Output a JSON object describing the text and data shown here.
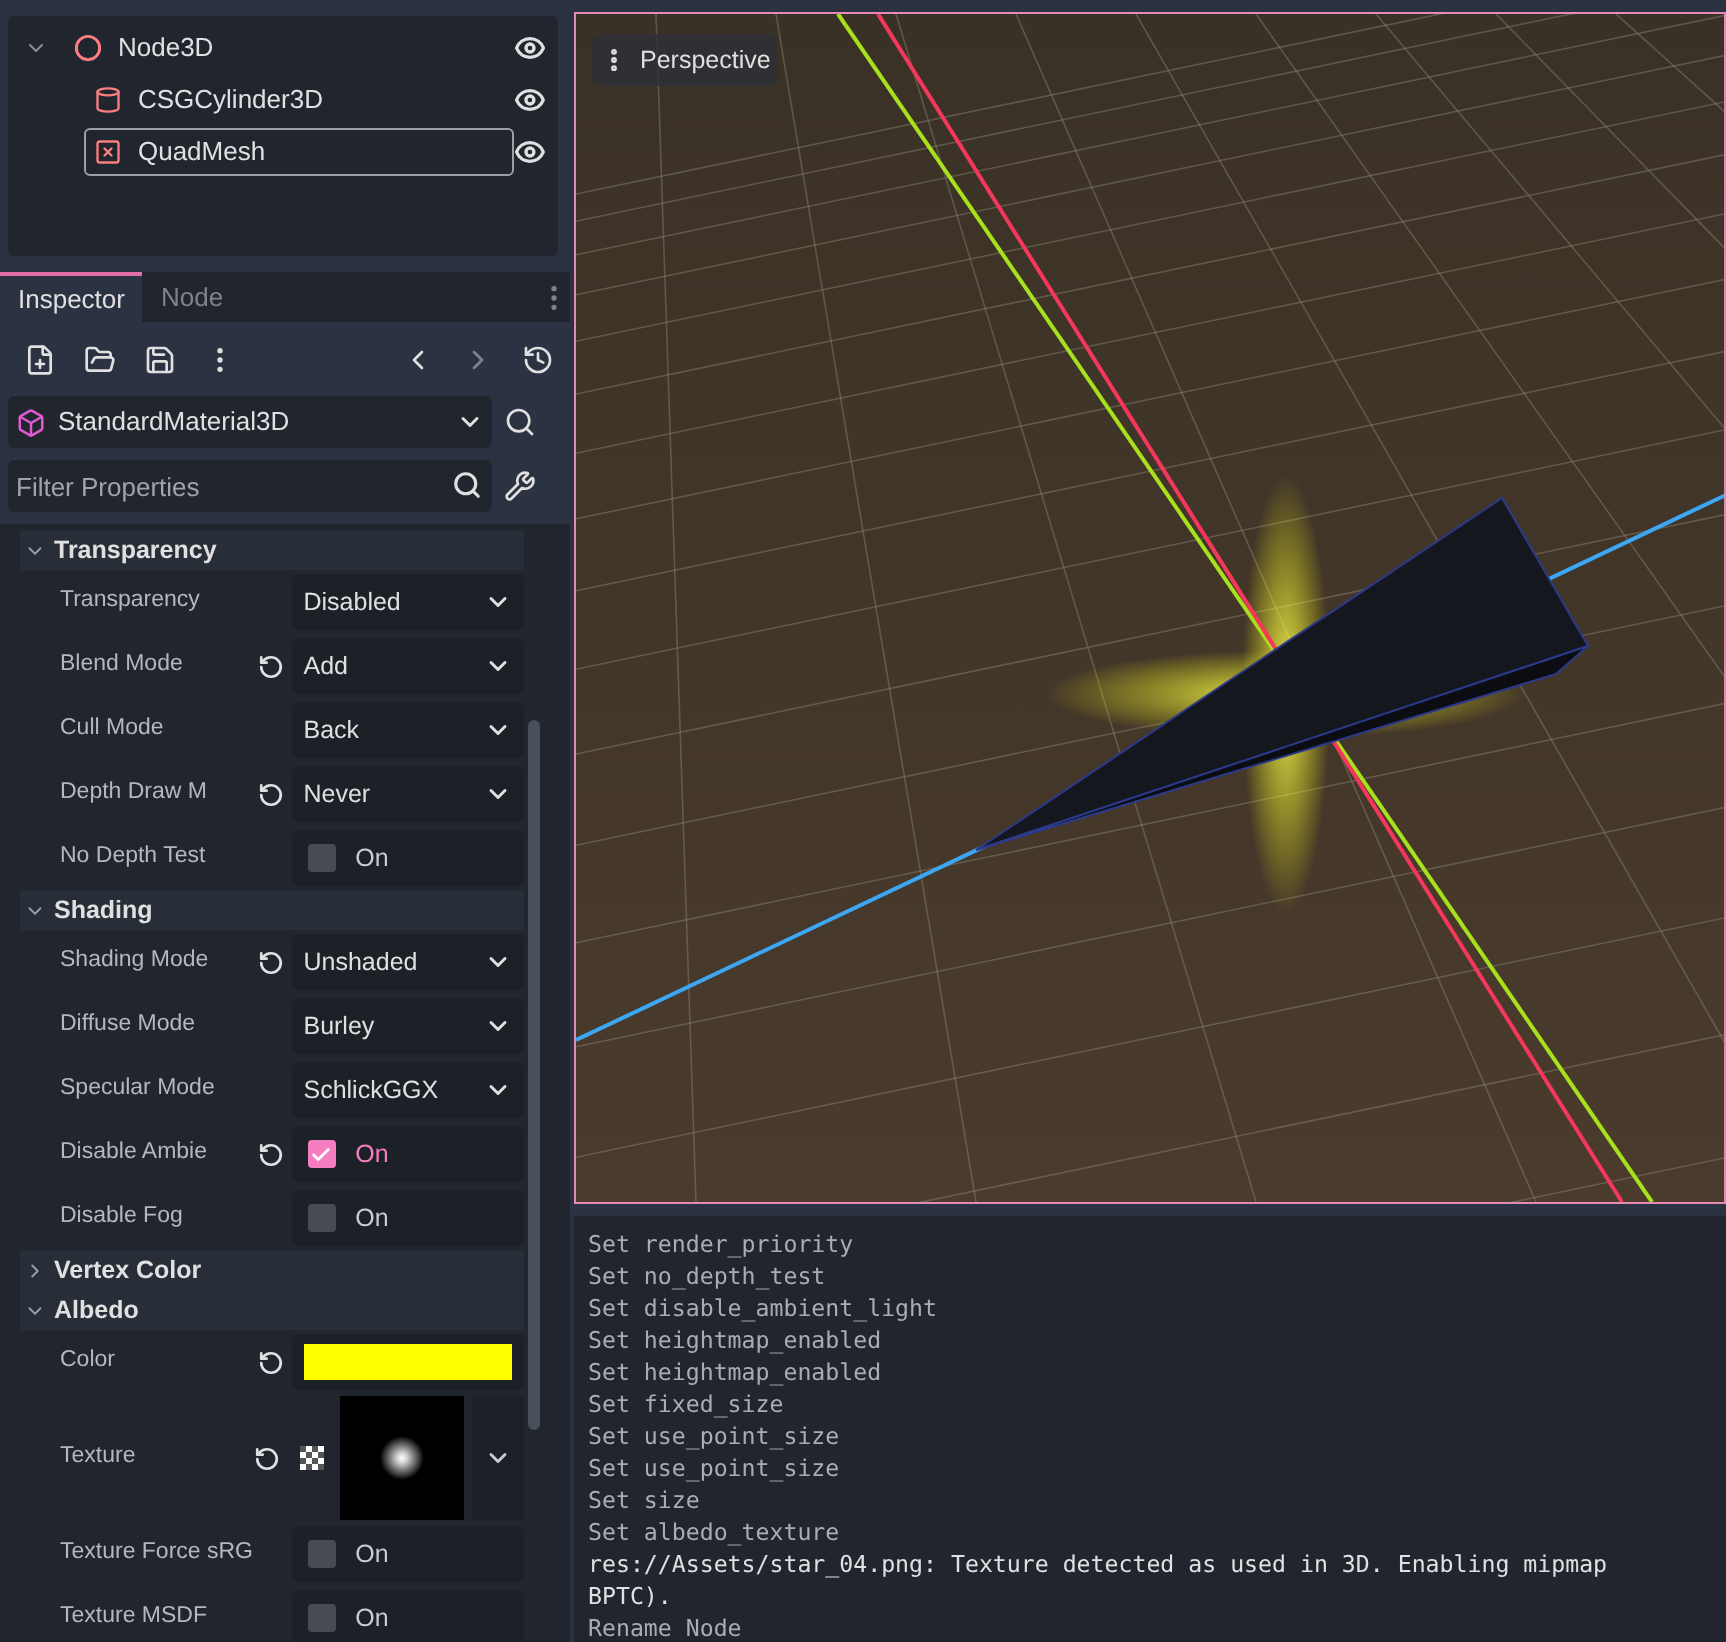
{
  "scene_tree": {
    "nodes": [
      {
        "name": "Node3D",
        "kind": "spatial",
        "expanded": true,
        "selected": false,
        "visible": true,
        "children": [
          {
            "name": "CSGCylinder3D",
            "kind": "csg",
            "selected": false,
            "visible": true
          },
          {
            "name": "QuadMesh",
            "kind": "mesh",
            "selected": true,
            "visible": true
          }
        ]
      }
    ]
  },
  "inspector": {
    "tabs": [
      {
        "label": "Inspector",
        "selected": true
      },
      {
        "label": "Node",
        "selected": false
      }
    ],
    "resource": "StandardMaterial3D",
    "filter": {
      "placeholder": "Filter Properties"
    },
    "sections": [
      {
        "title": "Transparency",
        "expanded": true,
        "properties": [
          {
            "kind": "dropdown",
            "label": "Transparency",
            "revertable": false,
            "value": "Disabled"
          },
          {
            "kind": "dropdown",
            "label": "Blend Mode",
            "revertable": true,
            "value": "Add"
          },
          {
            "kind": "dropdown",
            "label": "Cull Mode",
            "revertable": false,
            "value": "Back"
          },
          {
            "kind": "dropdown",
            "label": "Depth Draw M",
            "revertable": true,
            "value": "Never"
          },
          {
            "kind": "checkbox",
            "label": "No Depth Test",
            "revertable": false,
            "value": "On",
            "checked": false
          }
        ]
      },
      {
        "title": "Shading",
        "expanded": true,
        "properties": [
          {
            "kind": "dropdown",
            "label": "Shading Mode",
            "revertable": true,
            "value": "Unshaded"
          },
          {
            "kind": "dropdown",
            "label": "Diffuse Mode",
            "revertable": false,
            "value": "Burley"
          },
          {
            "kind": "dropdown",
            "label": "Specular Mode",
            "revertable": false,
            "value": "SchlickGGX"
          },
          {
            "kind": "checkbox",
            "label": "Disable Ambie",
            "revertable": true,
            "value": "On",
            "checked": true
          },
          {
            "kind": "checkbox",
            "label": "Disable Fog",
            "revertable": false,
            "value": "On",
            "checked": false
          }
        ]
      },
      {
        "title": "Vertex Color",
        "expanded": false
      },
      {
        "title": "Albedo",
        "expanded": true,
        "properties": [
          {
            "kind": "color",
            "label": "Color",
            "revertable": true,
            "color": "#ffff00"
          },
          {
            "kind": "texture",
            "label": "Texture",
            "revertable": true
          },
          {
            "kind": "checkbox",
            "label": "Texture Force sRG",
            "revertable": false,
            "value": "On",
            "checked": false
          },
          {
            "kind": "checkbox",
            "label": "Texture MSDF",
            "revertable": false,
            "value": "On",
            "checked": false
          }
        ]
      }
    ]
  },
  "viewport": {
    "view_menu": "Perspective"
  },
  "console": {
    "lines": [
      {
        "kind": "action",
        "text": "Set render_priority"
      },
      {
        "kind": "action",
        "text": "Set no_depth_test"
      },
      {
        "kind": "action",
        "text": "Set disable_ambient_light"
      },
      {
        "kind": "action",
        "text": "Set heightmap_enabled"
      },
      {
        "kind": "action",
        "text": "Set heightmap_enabled"
      },
      {
        "kind": "action",
        "text": "Set fixed_size"
      },
      {
        "kind": "action",
        "text": "Set use_point_size"
      },
      {
        "kind": "action",
        "text": "Set use_point_size"
      },
      {
        "kind": "action",
        "text": "Set size"
      },
      {
        "kind": "action",
        "text": "Set albedo_texture"
      },
      {
        "kind": "message",
        "text": "res://Assets/star_04.png: Texture detected as used in 3D. Enabling mipmap"
      },
      {
        "kind": "message",
        "text": "BPTC)."
      },
      {
        "kind": "action",
        "text": "Rename Node"
      }
    ]
  }
}
